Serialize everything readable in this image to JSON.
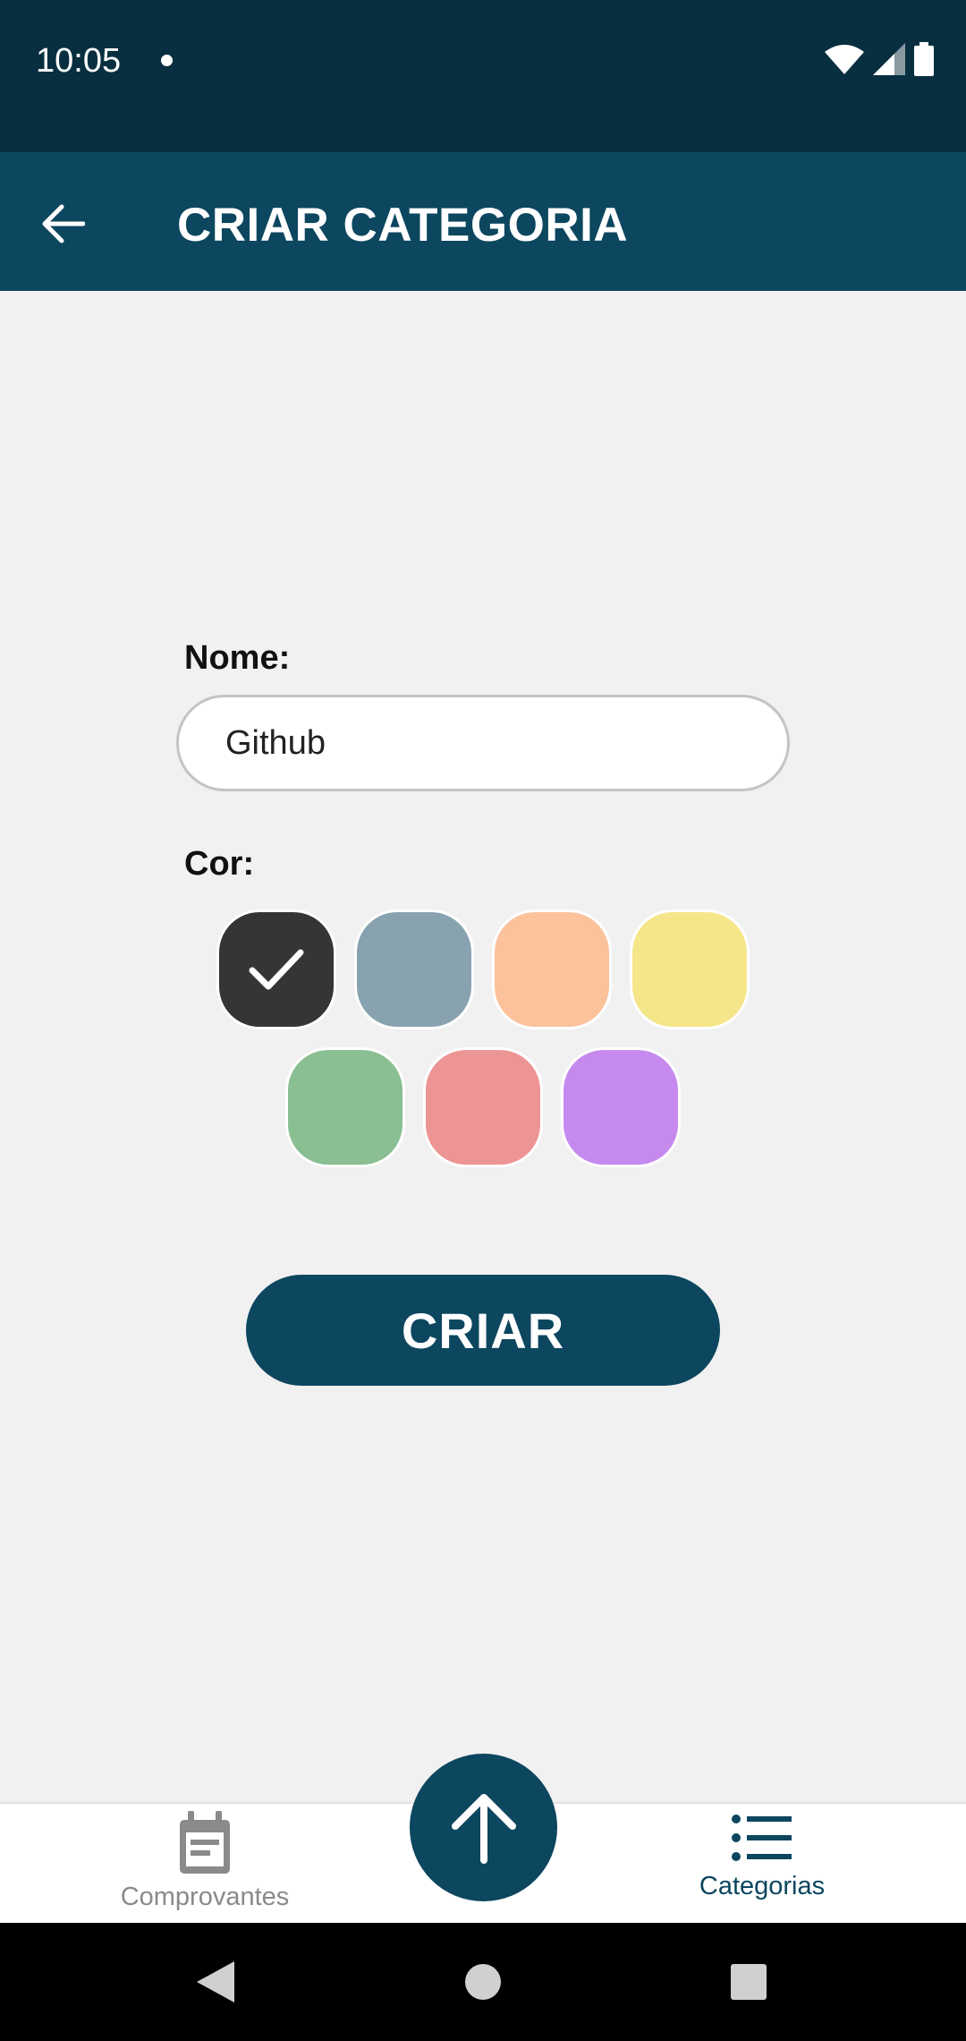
{
  "status_bar": {
    "time": "10:05"
  },
  "app_bar": {
    "title": "CRIAR CATEGORIA",
    "back_icon": "arrow-left-icon"
  },
  "form": {
    "name_label": "Nome:",
    "name_value": "Github",
    "color_label": "Cor:",
    "colors": [
      {
        "hex": "#353535",
        "selected": true
      },
      {
        "hex": "#88a2b0",
        "selected": false
      },
      {
        "hex": "#fbc29c",
        "selected": false
      },
      {
        "hex": "#f5e68a",
        "selected": false
      },
      {
        "hex": "#89bf92",
        "selected": false
      },
      {
        "hex": "#ed9594",
        "selected": false
      },
      {
        "hex": "#c68aee",
        "selected": false
      }
    ],
    "submit_label": "CRIAR"
  },
  "bottom_nav": {
    "items": [
      {
        "label": "Comprovantes",
        "icon": "receipt-icon",
        "active": false
      },
      {
        "label": "Categorias",
        "icon": "list-icon",
        "active": true
      }
    ],
    "fab_icon": "arrow-up-icon"
  },
  "theme": {
    "primary": "#0c465f",
    "status_bar": "#082f40",
    "background": "#f1f1f1"
  }
}
